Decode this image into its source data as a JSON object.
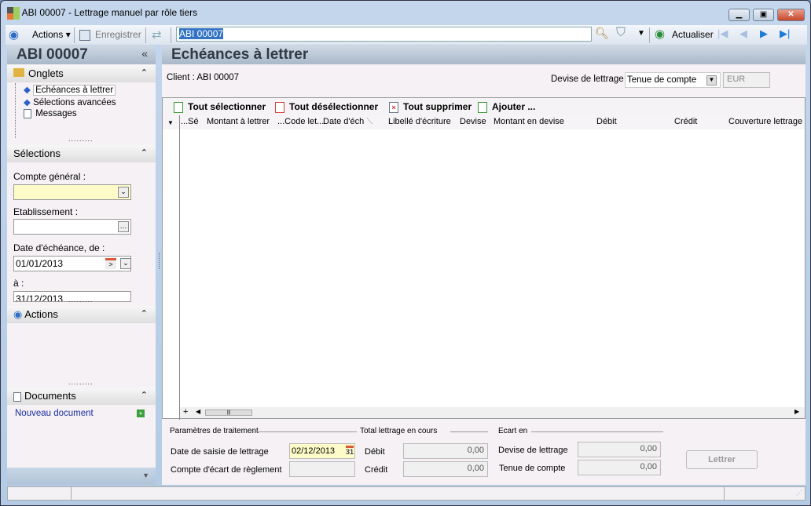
{
  "window": {
    "title": "ABI 00007 -  Lettrage manuel par rôle tiers"
  },
  "toolbar": {
    "actions": "Actions",
    "save": "Enregistrer",
    "search_value": "ABI 00007",
    "refresh": "Actualiser"
  },
  "left": {
    "title": "ABI 00007",
    "onglets": {
      "title": "Onglets",
      "items": [
        "Echéances à lettrer",
        "Sélections avancées",
        "Messages"
      ]
    },
    "selections": {
      "title": "Sélections",
      "compte_label": "Compte général :",
      "etab_label": "Etablissement :",
      "date_from_label": "Date d'échéance, de :",
      "date_from": "01/01/2013",
      "date_to_label": "à :",
      "date_to": "31/12/2013"
    },
    "actions": {
      "title": "Actions"
    },
    "documents": {
      "title": "Documents",
      "new": "Nouveau document"
    }
  },
  "main": {
    "title": "Echéances à lettrer",
    "client": "Client : ABI 00007",
    "devise_label": "Devise de lettrage :",
    "devise_value": "Tenue de compte",
    "currency": "EUR",
    "grid_buttons": [
      "Tout sélectionner",
      "Tout désélectionner",
      "Tout supprimer",
      "Ajouter ..."
    ],
    "columns": [
      "...Sé",
      "Montant à lettrer",
      "...Code let...",
      "Date d'éch",
      "Libellé d'écriture",
      "Devise",
      "Montant en devise",
      "Débit",
      "Crédit",
      "Couverture lettrage"
    ],
    "params": {
      "title": "Paramètres de traitement",
      "date_label": "Date de saisie de lettrage",
      "date_value": "02/12/2013",
      "compte_label": "Compte d'écart de règlement"
    },
    "total": {
      "title": "Total lettrage en cours",
      "debit_label": "Débit",
      "debit": "0,00",
      "credit_label": "Crédit",
      "credit": "0,00"
    },
    "ecart": {
      "title": "Ecart en",
      "devise_label": "Devise de lettrage",
      "devise": "0,00",
      "tenue_label": "Tenue de compte",
      "tenue": "0,00"
    },
    "lettrer": "Lettrer"
  }
}
